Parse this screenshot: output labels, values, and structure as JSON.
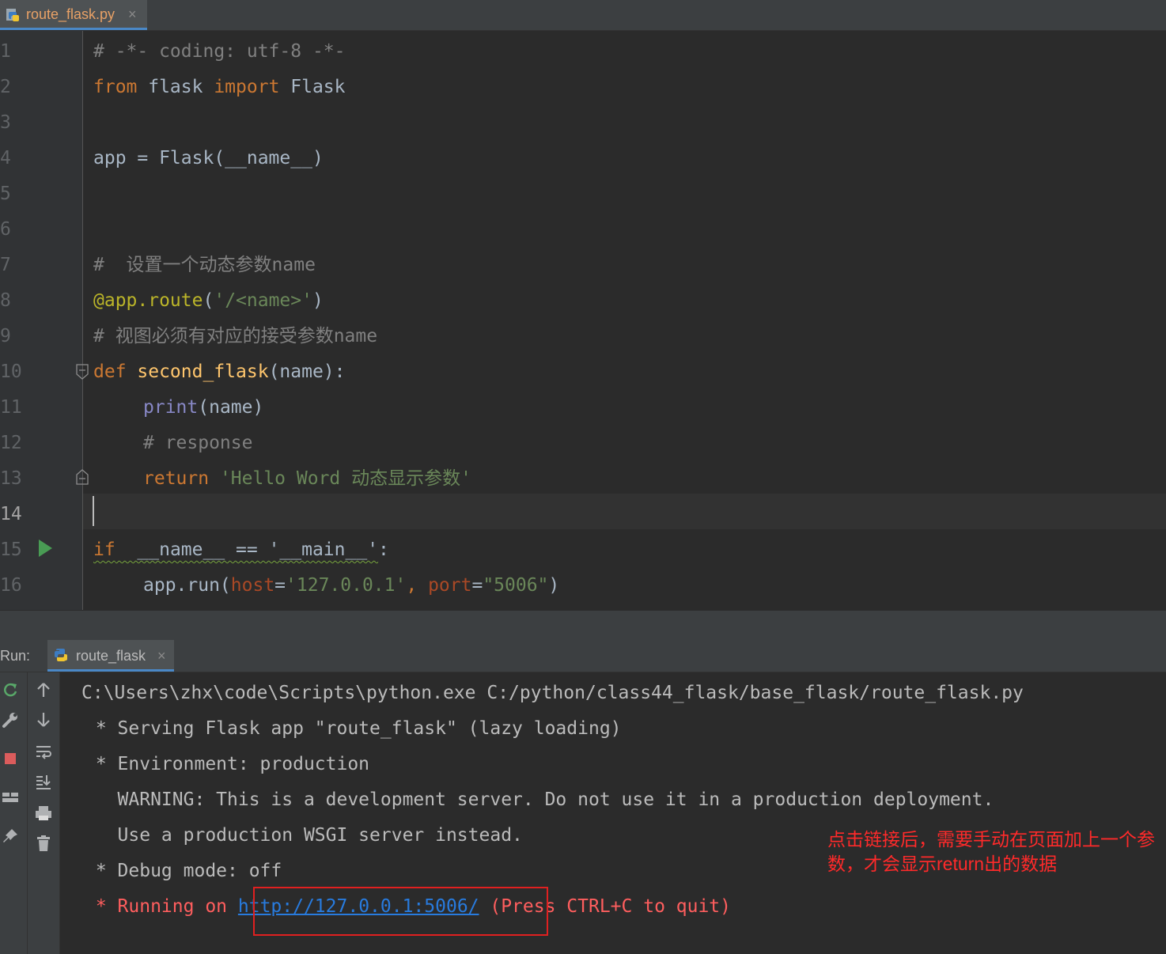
{
  "editor_tab": {
    "filename": "route_flask.py",
    "close": "×"
  },
  "gutter": {
    "line_numbers": [
      "1",
      "2",
      "3",
      "4",
      "5",
      "6",
      "7",
      "8",
      "9",
      "10",
      "11",
      "12",
      "13",
      "14",
      "15",
      "16"
    ]
  },
  "code": {
    "l1": "# -*- coding: utf-8 -*-",
    "l2_from": "from",
    "l2_mod": " flask ",
    "l2_import": "import",
    "l2_name": " Flask",
    "l4": "app = Flask(__name__)",
    "l7": "#  设置一个动态参数name",
    "l8_dec": "@app.route",
    "l8_open": "(",
    "l8_str": "'/<name>'",
    "l8_close": ")",
    "l9": "# 视图必须有对应的接受参数name",
    "l10_def": "def",
    "l10_fn": " second_flask",
    "l10_rest": "(name):",
    "l11_print": "print",
    "l11_rest": "(name)",
    "l12": "# response",
    "l13_return": "return",
    "l13_str": " 'Hello Word 动态显示参数'",
    "l15_if": "if",
    "l15_cond": "  __name__ == '__main__'",
    "l15_colon": ":",
    "l16_pre": "app.run(",
    "l16_host": "host",
    "l16_eq1": "=",
    "l16_hostval": "'127.0.0.1'",
    "l16_comma": ", ",
    "l16_port": "port",
    "l16_eq2": "=",
    "l16_portval": "\"5006\"",
    "l16_close": ")"
  },
  "run_panel": {
    "label": "Run:",
    "tab": "route_flask",
    "close": "×"
  },
  "console": {
    "line1": "C:\\Users\\zhx\\code\\Scripts\\python.exe C:/python/class44_flask/base_flask/route_flask.py",
    "line2": " * Serving Flask app \"route_flask\" (lazy loading)",
    "line3": " * Environment: production",
    "line4": "   WARNING: This is a development server. Do not use it in a production deployment.",
    "line5": "   Use a production WSGI server instead.",
    "line6": " * Debug mode: off",
    "line7_pre": " * Running on ",
    "line7_link": "http://127.0.0.1:5006/",
    "line7_post": " (Press CTRL+C to quit)"
  },
  "annotation": "点击链接后，需要手动在页面加上一个参数，才会显示return出的数据",
  "icons": [
    "python-file-icon",
    "run-arrow-icon",
    "rerun-icon",
    "wrench-icon",
    "stop-icon",
    "layout-icon",
    "pin-icon",
    "up-arrow-icon",
    "down-arrow-icon",
    "soft-wrap-icon",
    "scroll-to-end-icon",
    "print-icon",
    "trash-icon"
  ],
  "colors": {
    "keyword": "#cc7832",
    "string": "#6a8759",
    "comment": "#808080",
    "function": "#ffc66d",
    "error_output": "#ff5e5e",
    "link": "#287bde",
    "annotation": "#ff2a2a"
  }
}
